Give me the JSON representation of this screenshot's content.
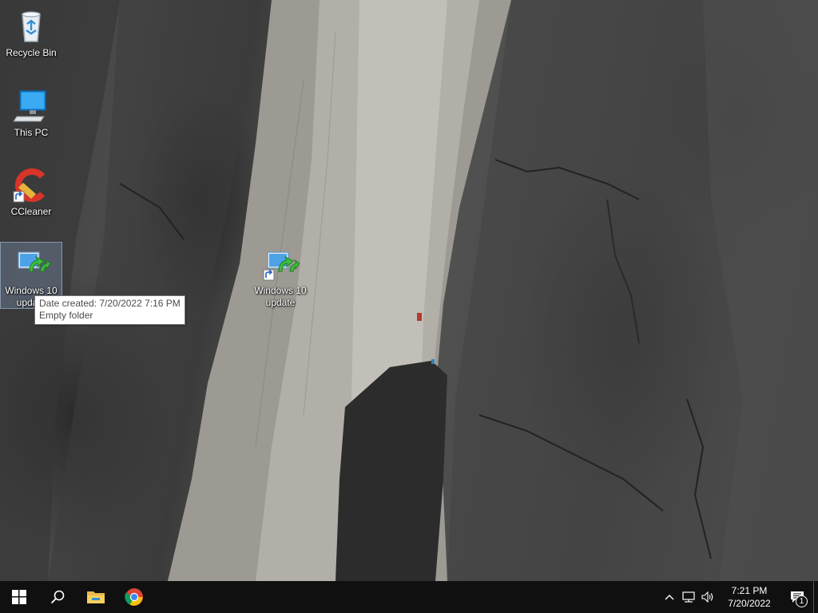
{
  "desktop": {
    "icons": [
      {
        "label": "Recycle Bin",
        "icon": "recycle-bin-icon"
      },
      {
        "label": "This PC",
        "icon": "this-pc-icon"
      },
      {
        "label": "CCleaner",
        "icon": "ccleaner-icon"
      },
      {
        "label": "Windows 10 update",
        "icon": "windows-update-folder-icon"
      },
      {
        "label": "Windows 10 update",
        "icon": "windows-update-folder-icon"
      }
    ],
    "tooltip": {
      "line1": "Date created: 7/20/2022 7:16 PM",
      "line2": "Empty folder"
    }
  },
  "taskbar": {
    "buttons": [
      {
        "icon": "windows-start-icon"
      },
      {
        "icon": "search-icon"
      },
      {
        "icon": "file-explorer-icon"
      },
      {
        "icon": "chrome-icon"
      }
    ],
    "tray": {
      "icons": [
        "chevron-up-icon",
        "network-icon",
        "volume-icon"
      ],
      "time": "7:21 PM",
      "date": "7/20/2022",
      "notification_count": "1"
    }
  }
}
